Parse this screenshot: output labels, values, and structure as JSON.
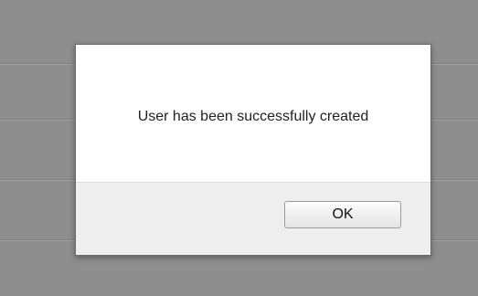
{
  "dialog": {
    "message": "User has been successfully created",
    "ok_label": "OK"
  }
}
